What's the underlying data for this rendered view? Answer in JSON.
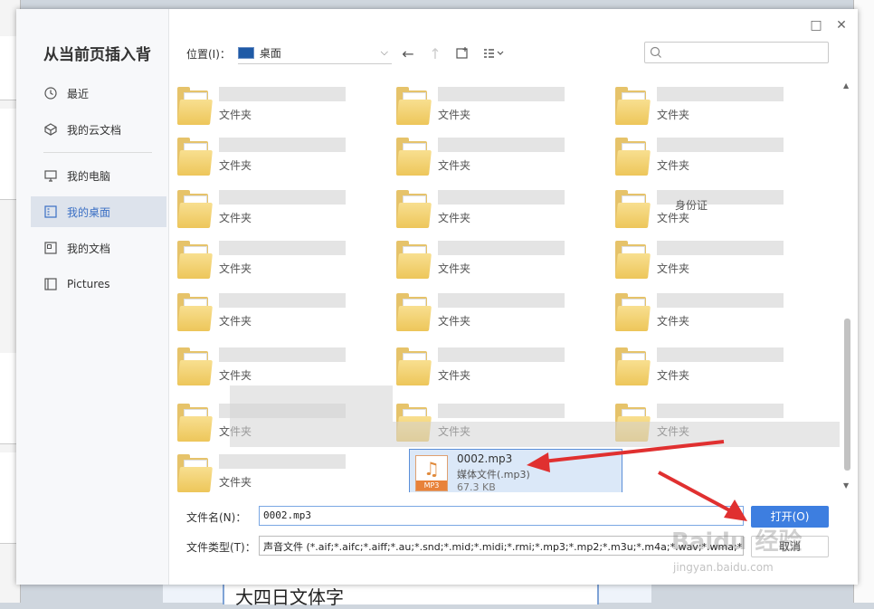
{
  "dialog": {
    "title": "从当前页插入背",
    "window_buttons": {
      "maximize": "□",
      "close": "✕"
    }
  },
  "sidebar": {
    "items": [
      {
        "label": "最近",
        "icon": "clock-icon"
      },
      {
        "label": "我的云文档",
        "icon": "cloud-doc-icon"
      },
      {
        "label": "我的电脑",
        "icon": "computer-icon"
      },
      {
        "label": "我的桌面",
        "icon": "desktop-icon",
        "active": true
      },
      {
        "label": "我的文档",
        "icon": "documents-icon"
      },
      {
        "label": "Pictures",
        "icon": "pictures-icon"
      }
    ]
  },
  "toolbar": {
    "location_label": "位置(I)：",
    "location_value": "桌面",
    "back_icon": "back-arrow-icon",
    "up_icon": "up-arrow-icon",
    "new_folder_icon": "new-folder-icon",
    "view_icon": "view-list-icon",
    "search_placeholder": ""
  },
  "files": {
    "folder_type": "文件夹",
    "partial_name": "身份证",
    "mp3": {
      "name": "0002.mp3",
      "type": "媒体文件(.mp3)",
      "size": "67.3 KB",
      "icon_label": "MP3"
    }
  },
  "form": {
    "filename_label": "文件名(N)：",
    "filename_value": "0002.mp3",
    "filetype_label": "文件类型(T)：",
    "filetype_value": "声音文件 (*.aif;*.aifc;*.aiff;*.au;*.snd;*.mid;*.midi;*.rmi;*.mp3;*.mp2;*.m3u;*.m4a;*.wav;*.wma;*.w",
    "open_button": "打开(O)",
    "cancel_button": "取消"
  },
  "background": {
    "doc_text": "大四日文体字"
  },
  "watermark": {
    "logo": "Baidu 经验",
    "url": "jingyan.baidu.com"
  },
  "colors": {
    "accent": "#3d7ee0",
    "selected_bg": "#dbe8f8",
    "arrow": "#e03030"
  }
}
